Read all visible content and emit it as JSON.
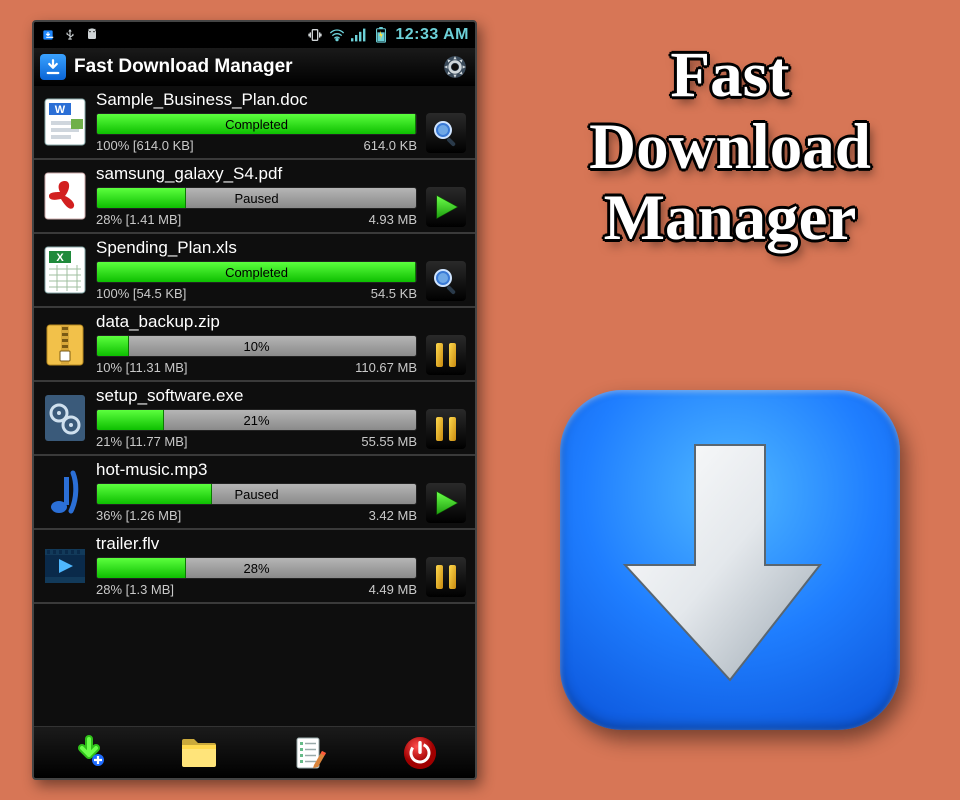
{
  "statusbar": {
    "time": "12:33 AM"
  },
  "titlebar": {
    "title": "Fast Download Manager"
  },
  "items": [
    {
      "name": "Sample_Business_Plan.doc",
      "progress": 100,
      "bar_label": "Completed",
      "left": "100% [614.0 KB]",
      "right": "614.0 KB",
      "icon": "word",
      "action": "search"
    },
    {
      "name": "samsung_galaxy_S4.pdf",
      "progress": 28,
      "bar_label": "Paused",
      "left": "28% [1.41 MB]",
      "right": "4.93 MB",
      "icon": "pdf",
      "action": "play"
    },
    {
      "name": "Spending_Plan.xls",
      "progress": 100,
      "bar_label": "Completed",
      "left": "100% [54.5 KB]",
      "right": "54.5 KB",
      "icon": "xls",
      "action": "search"
    },
    {
      "name": "data_backup.zip",
      "progress": 10,
      "bar_label": "10%",
      "left": "10% [11.31 MB]",
      "right": "110.67 MB",
      "icon": "zip",
      "action": "pause"
    },
    {
      "name": "setup_software.exe",
      "progress": 21,
      "bar_label": "21%",
      "left": "21% [11.77 MB]",
      "right": "55.55 MB",
      "icon": "exe",
      "action": "pause"
    },
    {
      "name": "hot-music.mp3",
      "progress": 36,
      "bar_label": "Paused",
      "left": "36% [1.26 MB]",
      "right": "3.42 MB",
      "icon": "mp3",
      "action": "play"
    },
    {
      "name": "trailer.flv",
      "progress": 28,
      "bar_label": "28%",
      "left": "28% [1.3 MB]",
      "right": "4.49 MB",
      "icon": "flv",
      "action": "pause"
    }
  ],
  "hero": {
    "line1": "Fast",
    "line2": "Download",
    "line3": "Manager"
  }
}
